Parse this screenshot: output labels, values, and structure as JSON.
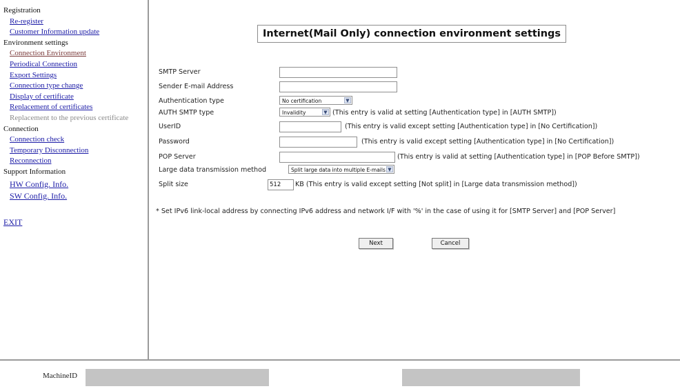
{
  "sidebar": {
    "registration_heading": "Registration",
    "re_register": "Re-register",
    "customer_info_update": "Customer Information update",
    "environment_heading": "Environment settings",
    "connection_environment": "Connection Environment",
    "periodical_connection": "Periodical Connection",
    "export_settings": "Export Settings",
    "connection_type_change": "Connection type change",
    "display_certificate": "Display of certificate",
    "replacement_certificates": "Replacement of certificates",
    "replacement_previous": "Replacement to the previous certificate",
    "connection_heading": "Connection",
    "connection_check": "Connection check",
    "temporary_disconnection": "Temporary Disconnection",
    "reconnection": "Reconnection",
    "support_heading": "Support Information",
    "hw_config": "HW Config. Info.",
    "sw_config": "SW Config. Info.",
    "exit": "EXIT"
  },
  "page": {
    "title": "Internet(Mail Only) connection environment settings"
  },
  "form": {
    "smtp_server_label": "SMTP Server",
    "smtp_server_value": "",
    "sender_email_label": "Sender E-mail Address",
    "sender_email_value": "",
    "auth_type_label": "Authentication type",
    "auth_type_value": "No certification",
    "auth_smtp_label": "AUTH SMTP type",
    "auth_smtp_value": "Invalidity",
    "auth_smtp_note": "(This entry is valid at setting [Authentication type] in [AUTH SMTP])",
    "userid_label": "UserID",
    "userid_value": "",
    "userid_note": "(This entry is valid except setting [Authentication type] in [No Certification])",
    "password_label": "Password",
    "password_value": "",
    "password_note": "(This entry is valid except setting [Authentication type] in [No Certification])",
    "pop_server_label": "POP Server",
    "pop_server_value": "",
    "pop_server_note": "(This entry is valid at setting [Authentication type] in [POP Before SMTP])",
    "large_data_label": "Large data transmission method",
    "large_data_value": "Split large data into multiple E-mails",
    "split_size_label": "Split size",
    "split_size_value": "512",
    "split_size_note": "KB (This entry is valid except setting [Not split] in [Large data transmission method])",
    "footnote": "* Set IPv6 link-local address by connecting IPv6 address and network I/F with '%' in the case of using it for [SMTP Server] and [POP Server]",
    "next_label": "Next",
    "cancel_label": "Cancel"
  },
  "footer": {
    "machine_id_label": "MachineID"
  },
  "icons": {
    "dropdown": "chevron-down-icon"
  }
}
